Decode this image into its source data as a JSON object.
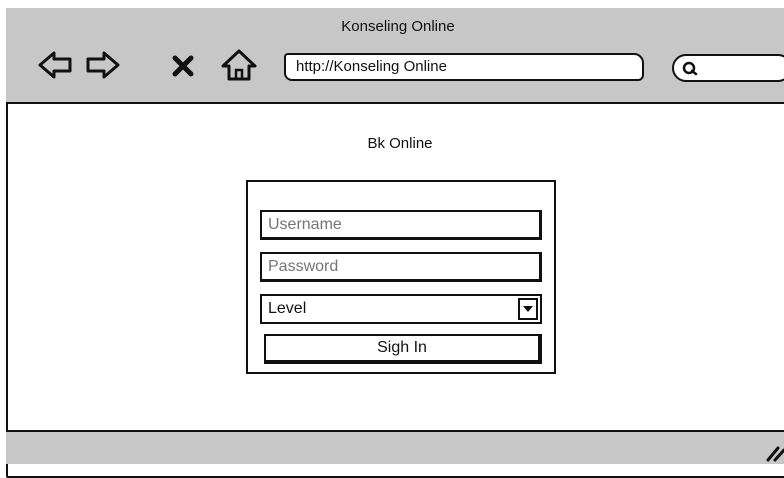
{
  "window": {
    "title": "Konseling Online"
  },
  "toolbar": {
    "back_icon": "back-arrow-icon",
    "forward_icon": "forward-arrow-icon",
    "stop_icon": "close-x-icon",
    "home_icon": "home-icon",
    "address_value": "http://Konseling Online",
    "search_icon": "search-icon"
  },
  "page": {
    "heading": "Bk Online"
  },
  "login": {
    "username_placeholder": "Username",
    "password_placeholder": "Password",
    "level_selected": "Level",
    "signin_label": "Sigh In"
  },
  "status": {
    "resize_icon": "resize-grip-icon"
  }
}
